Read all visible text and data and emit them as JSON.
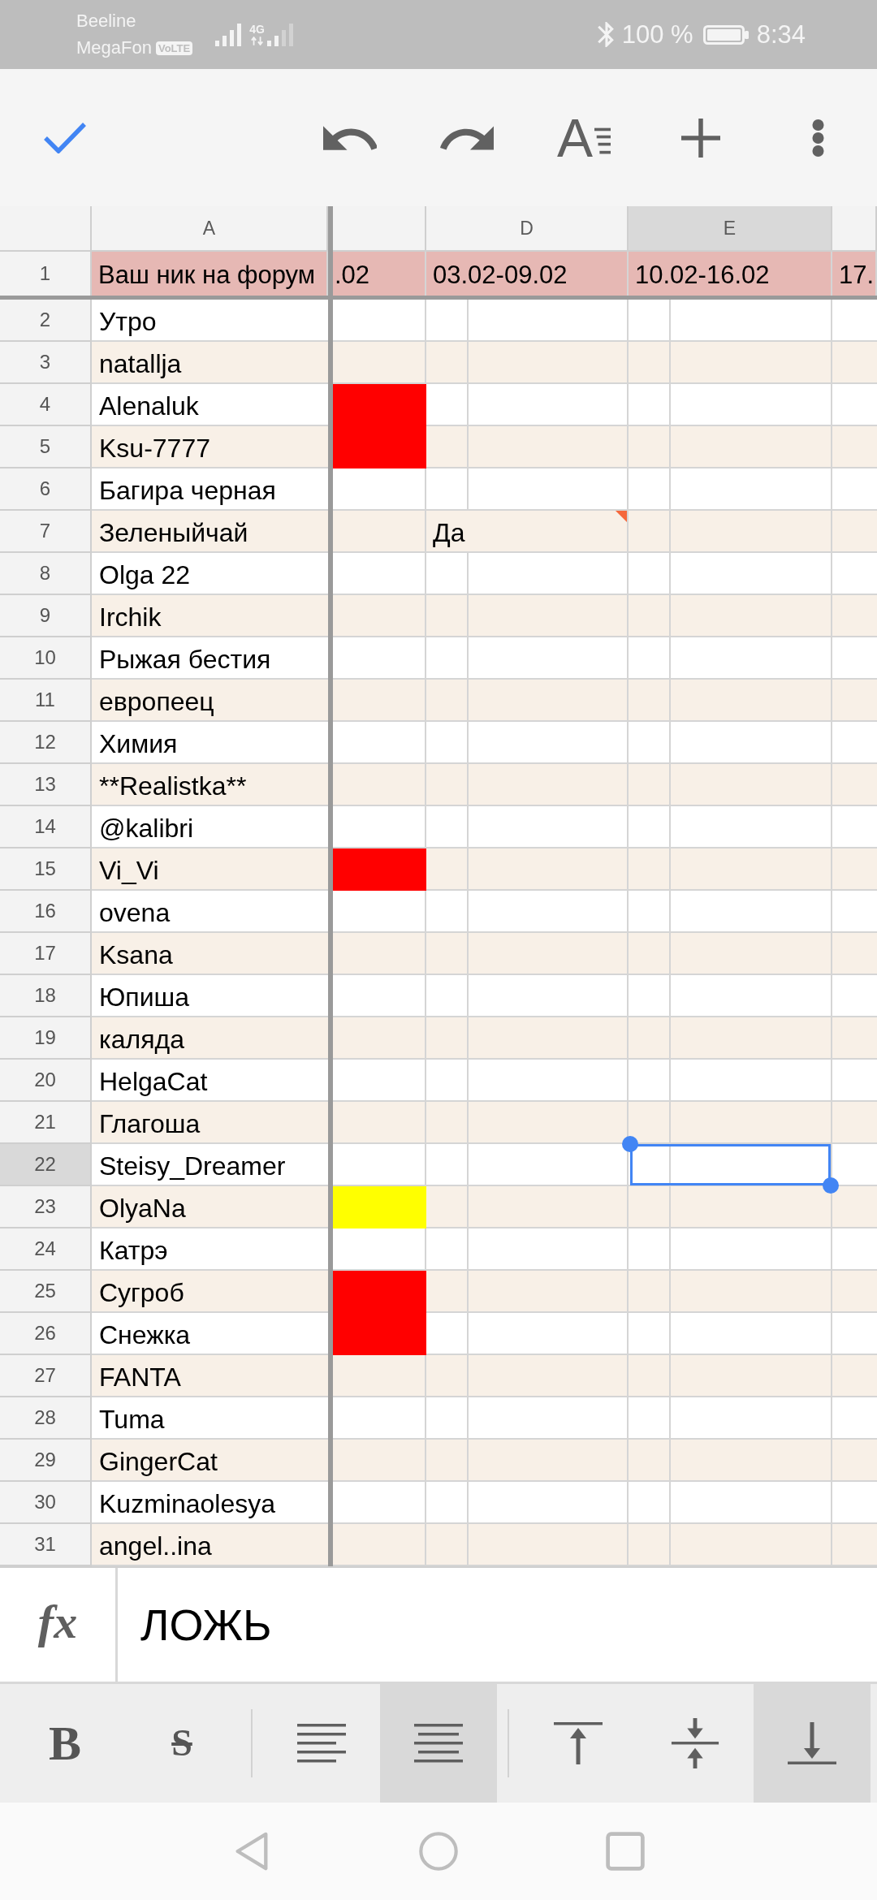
{
  "status_bar": {
    "carriers": [
      {
        "name": "Beeline"
      },
      {
        "name": "MegaFon",
        "badge": "VoLTE"
      }
    ],
    "network": "4G",
    "battery": "100 %",
    "time": "8:34"
  },
  "toolbar": {
    "buttons": [
      {
        "kind": "done"
      },
      {
        "kind": "undo"
      },
      {
        "kind": "redo"
      },
      {
        "kind": "text_format",
        "symbol": "A"
      },
      {
        "kind": "insert"
      },
      {
        "kind": "more"
      }
    ]
  },
  "sheet": {
    "columns": [
      {
        "label": "A",
        "selected": false
      },
      {
        "selected": false
      },
      {
        "label": "D",
        "selected": false
      },
      {
        "label": "E",
        "selected": true
      },
      {
        "selected": false
      }
    ],
    "header_row": {
      "number": "1",
      "cells": [
        "Ваш ник на форум",
        ".02",
        "03.02-09.02",
        "10.02-16.02",
        "17."
      ]
    },
    "rows": [
      {
        "number": "2",
        "name": "Утро",
        "selected": false
      },
      {
        "number": "3",
        "name": "natallja",
        "selected": false
      },
      {
        "number": "4",
        "name": "Alenaluk",
        "selected": false,
        "c_cell": {
          "color": "#ff0000"
        }
      },
      {
        "number": "5",
        "name": "Ksu-7777",
        "selected": false,
        "c_cell": {
          "color": "#ff0000"
        }
      },
      {
        "number": "6",
        "name": "Багира черная",
        "selected": false
      },
      {
        "number": "7",
        "name": "Зеленыйчай",
        "selected": false,
        "d_cell": {
          "text": "Да",
          "comment": true
        }
      },
      {
        "number": "8",
        "name": "Olga 22",
        "selected": false
      },
      {
        "number": "9",
        "name": "Irchik",
        "selected": false
      },
      {
        "number": "10",
        "name": "Рыжая бестия",
        "selected": false
      },
      {
        "number": "11",
        "name": "европеец",
        "selected": false
      },
      {
        "number": "12",
        "name": "Химия",
        "selected": false
      },
      {
        "number": "13",
        "name": "**Realistka**",
        "selected": false
      },
      {
        "number": "14",
        "name": "@kalibri",
        "selected": false
      },
      {
        "number": "15",
        "name": "Vi_Vi",
        "selected": false,
        "c_cell": {
          "color": "#ff0000"
        }
      },
      {
        "number": "16",
        "name": "ovena",
        "selected": false
      },
      {
        "number": "17",
        "name": "Ksana",
        "selected": false
      },
      {
        "number": "18",
        "name": "Юпиша",
        "selected": false
      },
      {
        "number": "19",
        "name": "каляда",
        "selected": false
      },
      {
        "number": "20",
        "name": "HelgaCat",
        "selected": false
      },
      {
        "number": "21",
        "name": "Глагоша",
        "selected": false
      },
      {
        "number": "22",
        "name": "Steisy_Dreamer",
        "selected": true
      },
      {
        "number": "23",
        "name": "OlyaNa",
        "selected": false,
        "c_cell": {
          "color": "#ffff00"
        }
      },
      {
        "number": "24",
        "name": "Катрэ",
        "selected": false
      },
      {
        "number": "25",
        "name": "Сугроб",
        "selected": false,
        "c_cell": {
          "color": "#ff0000"
        }
      },
      {
        "number": "26",
        "name": "Снежка",
        "selected": false,
        "c_cell": {
          "color": "#ff0000"
        }
      },
      {
        "number": "27",
        "name": "FANTA",
        "selected": false
      },
      {
        "number": "28",
        "name": "Tuma",
        "selected": false
      },
      {
        "number": "29",
        "name": "GingerCat",
        "selected": false
      },
      {
        "number": "30",
        "name": "Kuzminaolesya",
        "selected": false
      },
      {
        "number": "31",
        "name": "angel..ina",
        "selected": false
      }
    ]
  },
  "formula_bar": {
    "label": "fx",
    "value": "ЛОЖЬ"
  },
  "format_bar": {
    "groups": [
      [
        {
          "kind": "bold",
          "symbol": "B",
          "selected": false
        },
        {
          "kind": "strikethrough",
          "symbol": "S",
          "selected": false
        }
      ],
      [
        {
          "kind": "align_left",
          "selected": false
        },
        {
          "kind": "align_center",
          "selected": true
        }
      ],
      [
        {
          "kind": "align_top",
          "selected": false
        },
        {
          "kind": "align_middle",
          "selected": false
        },
        {
          "kind": "align_bottom",
          "selected": true
        }
      ]
    ]
  },
  "nav_bar": {
    "buttons": [
      {
        "kind": "back"
      },
      {
        "kind": "home"
      },
      {
        "kind": "recents"
      }
    ]
  }
}
